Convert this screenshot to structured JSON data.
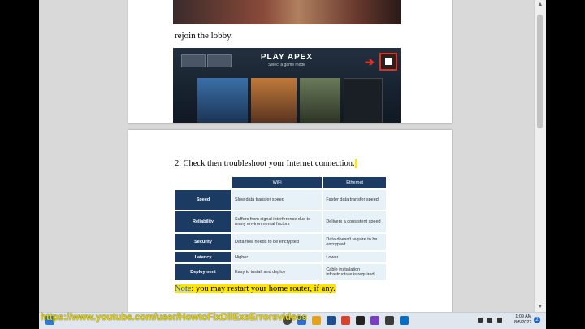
{
  "page1": {
    "line": "rejoin the lobby."
  },
  "apex": {
    "title": "PLAY APEX",
    "subtitle": "Select a game mode"
  },
  "page2": {
    "heading": "2. Check then troubleshoot your Internet connection.",
    "table": {
      "headers": [
        "WiFi",
        "Ethernet"
      ],
      "rows": [
        {
          "label": "Speed",
          "wifi": "Slow data transfer speed",
          "ethernet": "Faster data transfer speed"
        },
        {
          "label": "Reliability",
          "wifi": "Suffers from signal interference due to many environmental factors",
          "ethernet": "Delivers a consistent speed"
        },
        {
          "label": "Security",
          "wifi": "Data flow needs to be encrypted",
          "ethernet": "Data doesn't require to be encrypted"
        },
        {
          "label": "Latency",
          "wifi": "Higher",
          "ethernet": "Lower"
        },
        {
          "label": "Deployment",
          "wifi": "Easy to install and deploy",
          "ethernet": "Cable installation infrastructure is required"
        }
      ]
    },
    "note_label": "Note",
    "note_text": ": you may restart your home router, if any."
  },
  "overlay_url": "https://www.youtube.com/user/HowtoFixDllExeErrorsvideos",
  "taskbar": {
    "time": "1:09 AM",
    "date": "8/5/2022",
    "notification_count": "2"
  },
  "colors": {
    "table_header": "#1c3b63",
    "cell_bg": "#e7f1f8",
    "highlight": "#ffe600",
    "url": "#e8d400"
  }
}
